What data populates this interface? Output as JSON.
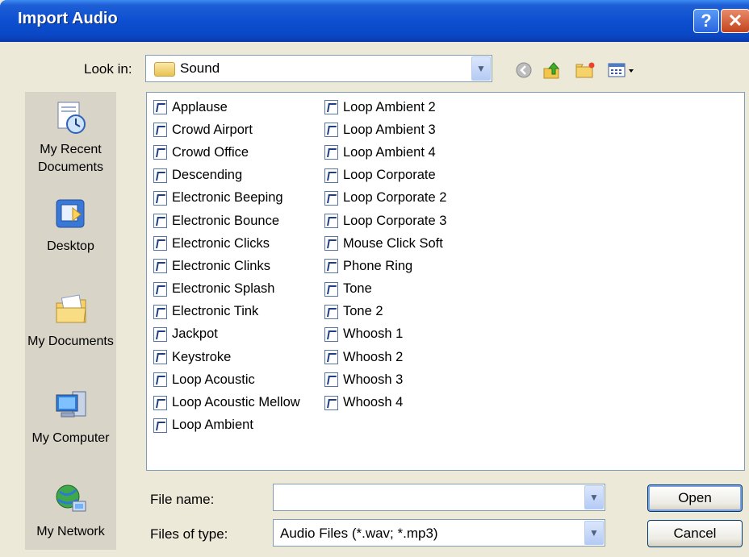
{
  "window": {
    "title": "Import Audio"
  },
  "titlebar": {
    "help_glyph": "?",
    "close_glyph": "✕"
  },
  "lookin": {
    "label": "Look in:",
    "value": "Sound"
  },
  "toolbar": {
    "icons": [
      "back-icon",
      "up-folder-icon",
      "new-folder-icon",
      "views-menu-icon"
    ]
  },
  "places": [
    {
      "label": "My Recent Documents",
      "icon": "recent-documents-icon"
    },
    {
      "label": "Desktop",
      "icon": "desktop-icon"
    },
    {
      "label": "My Documents",
      "icon": "my-documents-icon"
    },
    {
      "label": "My Computer",
      "icon": "my-computer-icon"
    },
    {
      "label": "My Network",
      "icon": "my-network-icon"
    }
  ],
  "files_col1": [
    "Applause",
    "Crowd Airport",
    "Crowd Office",
    "Descending",
    "Electronic Beeping",
    "Electronic Bounce",
    "Electronic Clicks",
    "Electronic Clinks",
    "Electronic Splash",
    "Electronic Tink",
    "Jackpot",
    "Keystroke",
    "Loop Acoustic",
    "Loop Acoustic Mellow",
    "Loop Ambient"
  ],
  "files_col2": [
    "Loop Ambient 2",
    "Loop Ambient 3",
    "Loop Ambient 4",
    "Loop Corporate",
    "Loop Corporate 2",
    "Loop Corporate 3",
    "Mouse Click Soft",
    "Phone Ring",
    "Tone",
    "Tone 2",
    "Whoosh 1",
    "Whoosh 2",
    "Whoosh 3",
    "Whoosh 4"
  ],
  "filename": {
    "label": "File name:",
    "value": ""
  },
  "filetype": {
    "label": "Files of type:",
    "value": "Audio Files (*.wav; *.mp3)"
  },
  "buttons": {
    "open": "Open",
    "cancel": "Cancel"
  },
  "colors": {
    "title_bar": "#0a47c4",
    "dialog_bg": "#ece9d8",
    "places_bg": "#d8d5c8",
    "border": "#7f9db9"
  }
}
